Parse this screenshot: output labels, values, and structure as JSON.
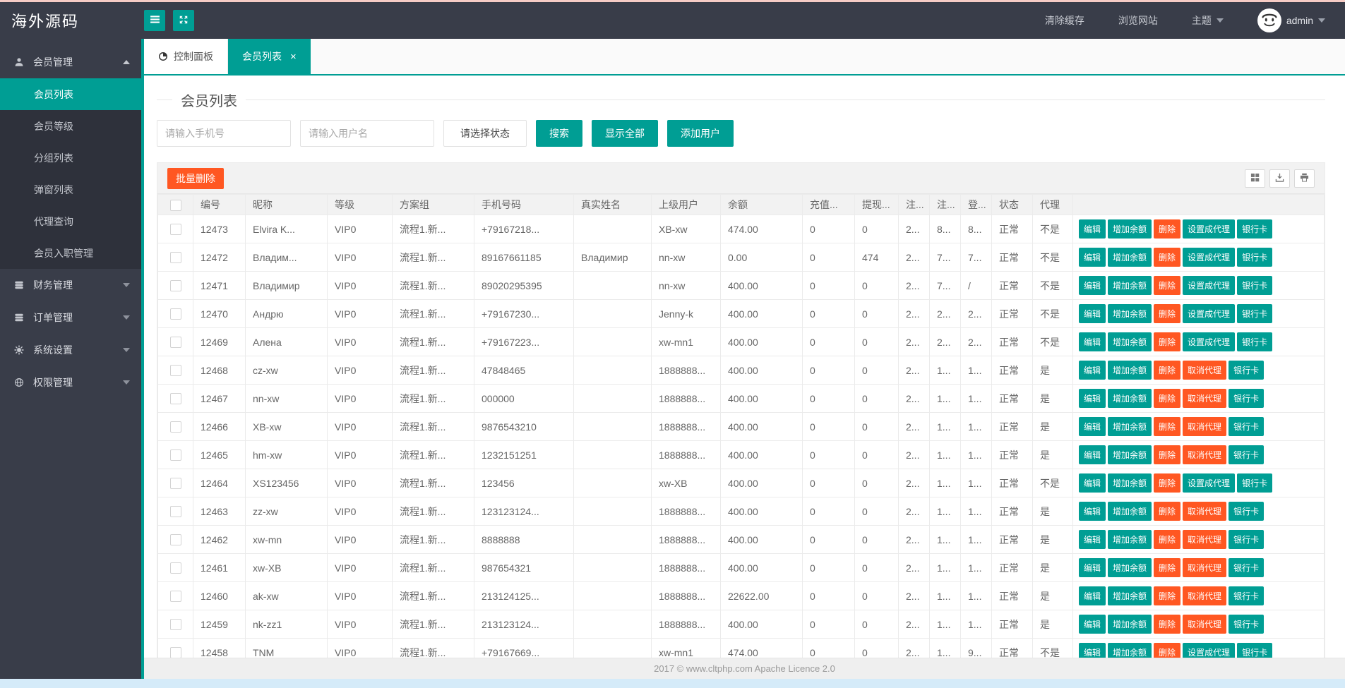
{
  "colors": {
    "accent": "#009E94",
    "danger": "#FF5722",
    "topbar_bg": "#393D49",
    "submenu_bg": "#2E313B",
    "top_strip": "#F6CCC5",
    "bottom_strip": "#D5EBF9"
  },
  "topbar": {
    "logo": "海外源码",
    "clear_cache": "清除缓存",
    "browse_site": "浏览网站",
    "theme": "主题",
    "username": "admin"
  },
  "sidebar": {
    "items": [
      {
        "key": "member-management",
        "label": "会员管理",
        "icon": "user-icon",
        "expanded": true,
        "children": [
          {
            "key": "member-list",
            "label": "会员列表",
            "active": true
          },
          {
            "key": "member-level",
            "label": "会员等级"
          },
          {
            "key": "group-list",
            "label": "分组列表"
          },
          {
            "key": "popup-list",
            "label": "弹窗列表"
          },
          {
            "key": "agent-query",
            "label": "代理查询"
          },
          {
            "key": "member-entry",
            "label": "会员入职管理"
          }
        ]
      },
      {
        "key": "finance-management",
        "label": "财务管理",
        "icon": "database-icon"
      },
      {
        "key": "order-management",
        "label": "订单管理",
        "icon": "database-icon"
      },
      {
        "key": "system-settings",
        "label": "系统设置",
        "icon": "gear-icon"
      },
      {
        "key": "permission-management",
        "label": "权限管理",
        "icon": "globe-icon"
      }
    ]
  },
  "tabs": [
    {
      "key": "console",
      "label": "控制面板",
      "icon": "console-icon"
    },
    {
      "key": "member-list",
      "label": "会员列表",
      "active": true,
      "closable": true
    }
  ],
  "page": {
    "title": "会员列表",
    "search": {
      "phone_placeholder": "请输入手机号",
      "username_placeholder": "请输入用户名",
      "status_placeholder": "请选择状态",
      "search_label": "搜索",
      "show_all_label": "显示全部",
      "add_user_label": "添加用户"
    },
    "toolbar": {
      "batch_delete_label": "批量删除",
      "icons": [
        "grid-icon",
        "export-icon",
        "print-icon"
      ]
    },
    "table": {
      "headers": [
        "编号",
        "昵称",
        "等级",
        "方案组",
        "手机号码",
        "真实姓名",
        "上级用户",
        "余额",
        "充值...",
        "提现...",
        "注...",
        "注...",
        "登...",
        "状态",
        "代理"
      ],
      "action_labels": {
        "edit": "编辑",
        "add_balance": "增加余额",
        "delete": "删除",
        "set_agent": "设置成代理",
        "cancel_agent": "取消代理",
        "bank_card": "银行卡"
      },
      "rows": [
        {
          "cells": [
            "12473",
            "Elvira K...",
            "VIP0",
            "流程1.新...",
            "+79167218...",
            "",
            "XB-xw",
            "474.00",
            "0",
            "0",
            "2...",
            "8...",
            "8...",
            "正常",
            "不是"
          ],
          "agent_action": "set"
        },
        {
          "cells": [
            "12472",
            "Владим...",
            "VIP0",
            "流程1.新...",
            "89167661185",
            "Владимир",
            "nn-xw",
            "0.00",
            "0",
            "474",
            "2...",
            "7...",
            "7...",
            "正常",
            "不是"
          ],
          "agent_action": "set"
        },
        {
          "cells": [
            "12471",
            "Владимир",
            "VIP0",
            "流程1.新...",
            "89020295395",
            "",
            "nn-xw",
            "400.00",
            "0",
            "0",
            "2...",
            "7...",
            "/",
            "正常",
            "不是"
          ],
          "agent_action": "set"
        },
        {
          "cells": [
            "12470",
            "Андрю",
            "VIP0",
            "流程1.新...",
            "+79167230...",
            "",
            "Jenny-k",
            "400.00",
            "0",
            "0",
            "2...",
            "2...",
            "2...",
            "正常",
            "不是"
          ],
          "agent_action": "set"
        },
        {
          "cells": [
            "12469",
            "Алена",
            "VIP0",
            "流程1.新...",
            "+79167223...",
            "",
            "xw-mn1",
            "400.00",
            "0",
            "0",
            "2...",
            "2...",
            "2...",
            "正常",
            "不是"
          ],
          "agent_action": "set"
        },
        {
          "cells": [
            "12468",
            "cz-xw",
            "VIP0",
            "流程1.新...",
            "47848465",
            "",
            "1888888...",
            "400.00",
            "0",
            "0",
            "2...",
            "1...",
            "1...",
            "正常",
            "是"
          ],
          "agent_action": "cancel"
        },
        {
          "cells": [
            "12467",
            "nn-xw",
            "VIP0",
            "流程1.新...",
            "000000",
            "",
            "1888888...",
            "400.00",
            "0",
            "0",
            "2...",
            "1...",
            "1...",
            "正常",
            "是"
          ],
          "agent_action": "cancel"
        },
        {
          "cells": [
            "12466",
            "XB-xw",
            "VIP0",
            "流程1.新...",
            "9876543210",
            "",
            "1888888...",
            "400.00",
            "0",
            "0",
            "2...",
            "1...",
            "1...",
            "正常",
            "是"
          ],
          "agent_action": "cancel"
        },
        {
          "cells": [
            "12465",
            "hm-xw",
            "VIP0",
            "流程1.新...",
            "1232151251",
            "",
            "1888888...",
            "400.00",
            "0",
            "0",
            "2...",
            "1...",
            "1...",
            "正常",
            "是"
          ],
          "agent_action": "cancel"
        },
        {
          "cells": [
            "12464",
            "XS123456",
            "VIP0",
            "流程1.新...",
            "123456",
            "",
            "xw-XB",
            "400.00",
            "0",
            "0",
            "2...",
            "1...",
            "1...",
            "正常",
            "不是"
          ],
          "agent_action": "set"
        },
        {
          "cells": [
            "12463",
            "zz-xw",
            "VIP0",
            "流程1.新...",
            "123123124...",
            "",
            "1888888...",
            "400.00",
            "0",
            "0",
            "2...",
            "1...",
            "1...",
            "正常",
            "是"
          ],
          "agent_action": "cancel"
        },
        {
          "cells": [
            "12462",
            "xw-mn",
            "VIP0",
            "流程1.新...",
            "8888888",
            "",
            "1888888...",
            "400.00",
            "0",
            "0",
            "2...",
            "1...",
            "1...",
            "正常",
            "是"
          ],
          "agent_action": "cancel"
        },
        {
          "cells": [
            "12461",
            "xw-XB",
            "VIP0",
            "流程1.新...",
            "987654321",
            "",
            "1888888...",
            "400.00",
            "0",
            "0",
            "2...",
            "1...",
            "1...",
            "正常",
            "是"
          ],
          "agent_action": "cancel"
        },
        {
          "cells": [
            "12460",
            "ak-xw",
            "VIP0",
            "流程1.新...",
            "213124125...",
            "",
            "1888888...",
            "22622.00",
            "0",
            "0",
            "2...",
            "1...",
            "1...",
            "正常",
            "是"
          ],
          "agent_action": "cancel"
        },
        {
          "cells": [
            "12459",
            "nk-zz1",
            "VIP0",
            "流程1.新...",
            "213123124...",
            "",
            "1888888...",
            "400.00",
            "0",
            "0",
            "2...",
            "1...",
            "1...",
            "正常",
            "是"
          ],
          "agent_action": "cancel"
        },
        {
          "cells": [
            "12458",
            "TNM",
            "VIP0",
            "流程1.新...",
            "+79167669...",
            "",
            "xw-mn1",
            "474.00",
            "0",
            "0",
            "2...",
            "1...",
            "9...",
            "正常",
            "不是"
          ],
          "agent_action": "set"
        }
      ]
    }
  },
  "footer": {
    "text": "2017 ©  www.cltphp.com  Apache Licence 2.0"
  }
}
